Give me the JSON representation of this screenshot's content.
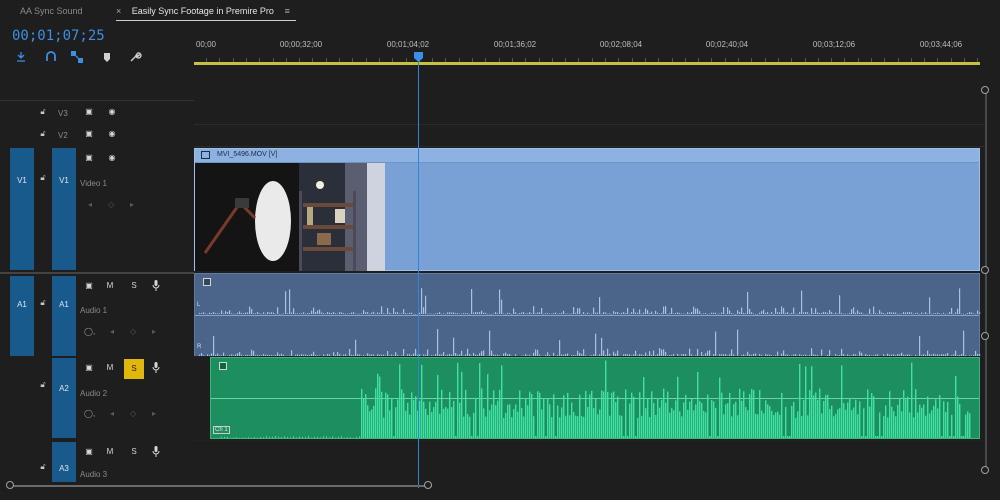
{
  "tabs": {
    "sync_sound": "AA  Sync Sound",
    "active_close": "×",
    "active_label": "Easily Sync Footage in Premire Pro",
    "active_menu": "≡"
  },
  "timecode": "00;01;07;25",
  "toolbar": {
    "tools": [
      "snap-icon",
      "link-icon",
      "linked-selection-icon",
      "marker-icon",
      "wrench-icon"
    ]
  },
  "ruler": {
    "labels": [
      "00;00",
      "00;00;32;00",
      "00;01;04;02",
      "00;01;36;02",
      "00;02;08;04",
      "00;02;40;04",
      "00;03;12;06",
      "00;03;44;06"
    ]
  },
  "tracks": {
    "v3": {
      "id": "V3"
    },
    "v2": {
      "id": "V2"
    },
    "v1": {
      "src": "V1",
      "id": "V1",
      "name": "Video 1"
    },
    "a1": {
      "src": "A1",
      "id": "A1",
      "name": "Audio 1",
      "mute": "M",
      "solo": "S"
    },
    "a2": {
      "id": "A2",
      "name": "Audio 2",
      "mute": "M",
      "solo": "S"
    },
    "a3": {
      "id": "A3",
      "name": "Audio 3",
      "mute": "M",
      "solo": "S"
    }
  },
  "clips": {
    "video_name": "MVI_5496.MOV [V]",
    "a1_badge_top": "L",
    "a1_badge_bottom": "R",
    "a2_badge": "Ch 1"
  },
  "colors": {
    "accent": "#3b8fe6",
    "video_clip": "#7aa1d6",
    "audio_clip_a1": "#4b6489",
    "audio_clip_a2": "#1d8f5f",
    "waveform_a2": "#3fe0a0",
    "solo_active": "#e2b70d",
    "work_area": "#c7c13d"
  }
}
